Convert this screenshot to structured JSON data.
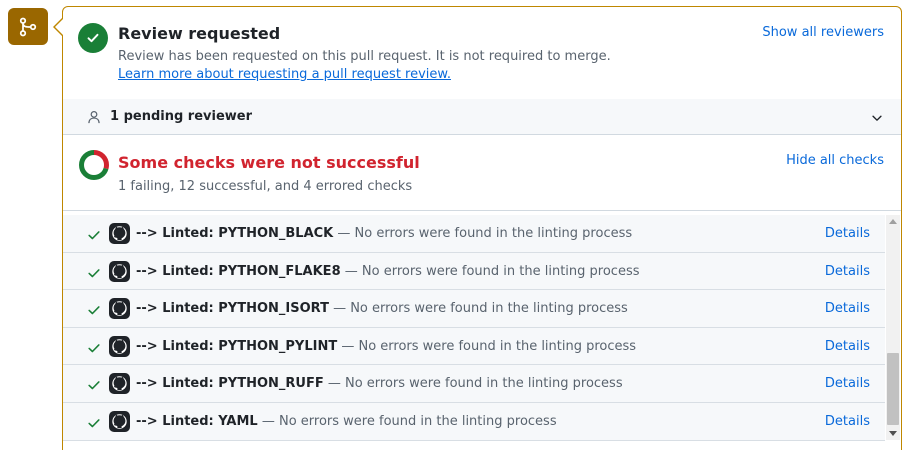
{
  "review": {
    "title": "Review requested",
    "description": "Review has been requested on this pull request. It is not required to merge.",
    "learn_link": "Learn more about requesting a pull request review.",
    "show_all_label": "Show all reviewers"
  },
  "pending": {
    "label": "1 pending reviewer"
  },
  "checks": {
    "title": "Some checks were not successful",
    "summary": "1 failing, 12 successful, and 4 errored checks",
    "hide_label": "Hide all checks",
    "status_counts": {
      "failing": 1,
      "successful": 12,
      "errored": 4
    },
    "items": [
      {
        "name": "--> Linted: PYTHON_BLACK",
        "description": " — No errors were found in the linting process",
        "details": "Details"
      },
      {
        "name": "--> Linted: PYTHON_FLAKE8",
        "description": " — No errors were found in the linting process",
        "details": "Details"
      },
      {
        "name": "--> Linted: PYTHON_ISORT",
        "description": " — No errors were found in the linting process",
        "details": "Details"
      },
      {
        "name": "--> Linted: PYTHON_PYLINT",
        "description": " — No errors were found in the linting process",
        "details": "Details"
      },
      {
        "name": "--> Linted: PYTHON_RUFF",
        "description": " — No errors were found in the linting process",
        "details": "Details"
      },
      {
        "name": "--> Linted: YAML",
        "description": " — No errors were found in the linting process",
        "details": "Details"
      }
    ]
  },
  "colors": {
    "merge_badge": "#9a6700",
    "panel_border": "#bf8700",
    "success": "#1a7f37",
    "failure": "#d1242f",
    "link": "#0969da",
    "muted_text": "#59636e"
  },
  "icons": {
    "merge": "git-merge-icon",
    "review_ok": "check-circle-icon",
    "person": "person-icon",
    "chevron": "chevron-down-icon",
    "checks_status": "checks-donut-icon",
    "check": "check-icon",
    "app": "github-logo-icon"
  }
}
